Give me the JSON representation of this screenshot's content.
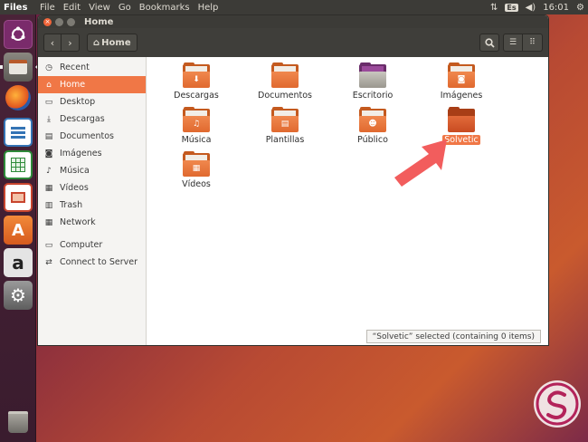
{
  "top_panel": {
    "app_name": "Files",
    "menu": [
      "File",
      "Edit",
      "View",
      "Go",
      "Bookmarks",
      "Help"
    ],
    "keyboard_layout": "Es",
    "time": "16:01"
  },
  "launcher": {
    "items": [
      {
        "name": "ubuntu-logo-icon",
        "color": "#7a2b6b"
      },
      {
        "name": "files-icon",
        "color": "#6d6b66"
      },
      {
        "name": "firefox-icon",
        "color": "#e86a1f"
      },
      {
        "name": "writer-icon",
        "color": "#3474b5"
      },
      {
        "name": "calc-icon",
        "color": "#2e8b3a"
      },
      {
        "name": "impress-icon",
        "color": "#c8452e"
      },
      {
        "name": "software-center-icon",
        "color": "#e36b2b"
      },
      {
        "name": "amazon-icon",
        "color": "#dcdcdc"
      },
      {
        "name": "system-settings-icon",
        "color": "#8a8a8a"
      },
      {
        "name": "trash-icon",
        "color": "#6d6b66"
      }
    ]
  },
  "window": {
    "title": "Home",
    "path_button": "Home"
  },
  "sidebar": {
    "items": [
      {
        "label": "Recent",
        "icon": "clock-icon",
        "glyph": "◷"
      },
      {
        "label": "Home",
        "icon": "home-icon",
        "glyph": "⌂"
      },
      {
        "label": "Desktop",
        "icon": "desktop-icon",
        "glyph": "▭"
      },
      {
        "label": "Descargas",
        "icon": "download-icon",
        "glyph": "⤓"
      },
      {
        "label": "Documentos",
        "icon": "document-icon",
        "glyph": "▤"
      },
      {
        "label": "Imágenes",
        "icon": "camera-icon",
        "glyph": "◙"
      },
      {
        "label": "Música",
        "icon": "music-icon",
        "glyph": "♪"
      },
      {
        "label": "Vídeos",
        "icon": "video-icon",
        "glyph": "▦"
      },
      {
        "label": "Trash",
        "icon": "trash-icon",
        "glyph": "▥"
      },
      {
        "label": "Network",
        "icon": "network-icon",
        "glyph": "▦"
      }
    ],
    "items2": [
      {
        "label": "Computer",
        "icon": "computer-icon",
        "glyph": "▭"
      },
      {
        "label": "Connect to Server",
        "icon": "server-icon",
        "glyph": "⇄"
      }
    ],
    "active": "Home"
  },
  "files": [
    {
      "label": "Descargas",
      "icon": "downloads-folder-icon",
      "emblem": "⬇"
    },
    {
      "label": "Documentos",
      "icon": "documents-folder-icon",
      "emblem": ""
    },
    {
      "label": "Escritorio",
      "icon": "desktop-folder-icon",
      "emblem": ""
    },
    {
      "label": "Imágenes",
      "icon": "pictures-folder-icon",
      "emblem": "◙"
    },
    {
      "label": "Música",
      "icon": "music-folder-icon",
      "emblem": "♫"
    },
    {
      "label": "Plantillas",
      "icon": "templates-folder-icon",
      "emblem": "▤"
    },
    {
      "label": "Público",
      "icon": "public-folder-icon",
      "emblem": "☻"
    },
    {
      "label": "Solvetic",
      "icon": "folder-icon",
      "emblem": "",
      "selected": true
    },
    {
      "label": "Vídeos",
      "icon": "videos-folder-icon",
      "emblem": "▦"
    }
  ],
  "status": "“Solvetic” selected  (containing 0 items)"
}
